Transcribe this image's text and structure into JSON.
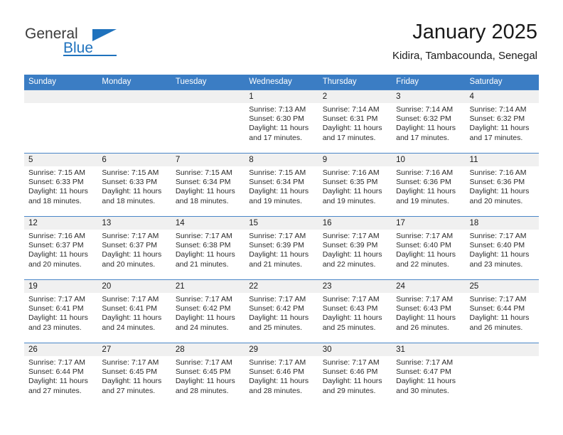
{
  "brand": {
    "line1": "General",
    "line2": "Blue",
    "flag_icon": "blue-triangle-flag-icon"
  },
  "header": {
    "title": "January 2025",
    "subtitle": "Kidira, Tambacounda, Senegal"
  },
  "colors": {
    "header_blue": "#3b7dc4",
    "brand_blue": "#1f72bd",
    "daynum_band": "#f0f0f0",
    "text": "#1a1a1a"
  },
  "weekday_headers": [
    "Sunday",
    "Monday",
    "Tuesday",
    "Wednesday",
    "Thursday",
    "Friday",
    "Saturday"
  ],
  "weeks": [
    [
      {
        "day": "",
        "sunrise": "",
        "sunset": "",
        "daylight1": "",
        "daylight2": ""
      },
      {
        "day": "",
        "sunrise": "",
        "sunset": "",
        "daylight1": "",
        "daylight2": ""
      },
      {
        "day": "",
        "sunrise": "",
        "sunset": "",
        "daylight1": "",
        "daylight2": ""
      },
      {
        "day": "1",
        "sunrise": "Sunrise: 7:13 AM",
        "sunset": "Sunset: 6:30 PM",
        "daylight1": "Daylight: 11 hours",
        "daylight2": "and 17 minutes."
      },
      {
        "day": "2",
        "sunrise": "Sunrise: 7:14 AM",
        "sunset": "Sunset: 6:31 PM",
        "daylight1": "Daylight: 11 hours",
        "daylight2": "and 17 minutes."
      },
      {
        "day": "3",
        "sunrise": "Sunrise: 7:14 AM",
        "sunset": "Sunset: 6:32 PM",
        "daylight1": "Daylight: 11 hours",
        "daylight2": "and 17 minutes."
      },
      {
        "day": "4",
        "sunrise": "Sunrise: 7:14 AM",
        "sunset": "Sunset: 6:32 PM",
        "daylight1": "Daylight: 11 hours",
        "daylight2": "and 17 minutes."
      }
    ],
    [
      {
        "day": "5",
        "sunrise": "Sunrise: 7:15 AM",
        "sunset": "Sunset: 6:33 PM",
        "daylight1": "Daylight: 11 hours",
        "daylight2": "and 18 minutes."
      },
      {
        "day": "6",
        "sunrise": "Sunrise: 7:15 AM",
        "sunset": "Sunset: 6:33 PM",
        "daylight1": "Daylight: 11 hours",
        "daylight2": "and 18 minutes."
      },
      {
        "day": "7",
        "sunrise": "Sunrise: 7:15 AM",
        "sunset": "Sunset: 6:34 PM",
        "daylight1": "Daylight: 11 hours",
        "daylight2": "and 18 minutes."
      },
      {
        "day": "8",
        "sunrise": "Sunrise: 7:15 AM",
        "sunset": "Sunset: 6:34 PM",
        "daylight1": "Daylight: 11 hours",
        "daylight2": "and 19 minutes."
      },
      {
        "day": "9",
        "sunrise": "Sunrise: 7:16 AM",
        "sunset": "Sunset: 6:35 PM",
        "daylight1": "Daylight: 11 hours",
        "daylight2": "and 19 minutes."
      },
      {
        "day": "10",
        "sunrise": "Sunrise: 7:16 AM",
        "sunset": "Sunset: 6:36 PM",
        "daylight1": "Daylight: 11 hours",
        "daylight2": "and 19 minutes."
      },
      {
        "day": "11",
        "sunrise": "Sunrise: 7:16 AM",
        "sunset": "Sunset: 6:36 PM",
        "daylight1": "Daylight: 11 hours",
        "daylight2": "and 20 minutes."
      }
    ],
    [
      {
        "day": "12",
        "sunrise": "Sunrise: 7:16 AM",
        "sunset": "Sunset: 6:37 PM",
        "daylight1": "Daylight: 11 hours",
        "daylight2": "and 20 minutes."
      },
      {
        "day": "13",
        "sunrise": "Sunrise: 7:17 AM",
        "sunset": "Sunset: 6:37 PM",
        "daylight1": "Daylight: 11 hours",
        "daylight2": "and 20 minutes."
      },
      {
        "day": "14",
        "sunrise": "Sunrise: 7:17 AM",
        "sunset": "Sunset: 6:38 PM",
        "daylight1": "Daylight: 11 hours",
        "daylight2": "and 21 minutes."
      },
      {
        "day": "15",
        "sunrise": "Sunrise: 7:17 AM",
        "sunset": "Sunset: 6:39 PM",
        "daylight1": "Daylight: 11 hours",
        "daylight2": "and 21 minutes."
      },
      {
        "day": "16",
        "sunrise": "Sunrise: 7:17 AM",
        "sunset": "Sunset: 6:39 PM",
        "daylight1": "Daylight: 11 hours",
        "daylight2": "and 22 minutes."
      },
      {
        "day": "17",
        "sunrise": "Sunrise: 7:17 AM",
        "sunset": "Sunset: 6:40 PM",
        "daylight1": "Daylight: 11 hours",
        "daylight2": "and 22 minutes."
      },
      {
        "day": "18",
        "sunrise": "Sunrise: 7:17 AM",
        "sunset": "Sunset: 6:40 PM",
        "daylight1": "Daylight: 11 hours",
        "daylight2": "and 23 minutes."
      }
    ],
    [
      {
        "day": "19",
        "sunrise": "Sunrise: 7:17 AM",
        "sunset": "Sunset: 6:41 PM",
        "daylight1": "Daylight: 11 hours",
        "daylight2": "and 23 minutes."
      },
      {
        "day": "20",
        "sunrise": "Sunrise: 7:17 AM",
        "sunset": "Sunset: 6:41 PM",
        "daylight1": "Daylight: 11 hours",
        "daylight2": "and 24 minutes."
      },
      {
        "day": "21",
        "sunrise": "Sunrise: 7:17 AM",
        "sunset": "Sunset: 6:42 PM",
        "daylight1": "Daylight: 11 hours",
        "daylight2": "and 24 minutes."
      },
      {
        "day": "22",
        "sunrise": "Sunrise: 7:17 AM",
        "sunset": "Sunset: 6:42 PM",
        "daylight1": "Daylight: 11 hours",
        "daylight2": "and 25 minutes."
      },
      {
        "day": "23",
        "sunrise": "Sunrise: 7:17 AM",
        "sunset": "Sunset: 6:43 PM",
        "daylight1": "Daylight: 11 hours",
        "daylight2": "and 25 minutes."
      },
      {
        "day": "24",
        "sunrise": "Sunrise: 7:17 AM",
        "sunset": "Sunset: 6:43 PM",
        "daylight1": "Daylight: 11 hours",
        "daylight2": "and 26 minutes."
      },
      {
        "day": "25",
        "sunrise": "Sunrise: 7:17 AM",
        "sunset": "Sunset: 6:44 PM",
        "daylight1": "Daylight: 11 hours",
        "daylight2": "and 26 minutes."
      }
    ],
    [
      {
        "day": "26",
        "sunrise": "Sunrise: 7:17 AM",
        "sunset": "Sunset: 6:44 PM",
        "daylight1": "Daylight: 11 hours",
        "daylight2": "and 27 minutes."
      },
      {
        "day": "27",
        "sunrise": "Sunrise: 7:17 AM",
        "sunset": "Sunset: 6:45 PM",
        "daylight1": "Daylight: 11 hours",
        "daylight2": "and 27 minutes."
      },
      {
        "day": "28",
        "sunrise": "Sunrise: 7:17 AM",
        "sunset": "Sunset: 6:45 PM",
        "daylight1": "Daylight: 11 hours",
        "daylight2": "and 28 minutes."
      },
      {
        "day": "29",
        "sunrise": "Sunrise: 7:17 AM",
        "sunset": "Sunset: 6:46 PM",
        "daylight1": "Daylight: 11 hours",
        "daylight2": "and 28 minutes."
      },
      {
        "day": "30",
        "sunrise": "Sunrise: 7:17 AM",
        "sunset": "Sunset: 6:46 PM",
        "daylight1": "Daylight: 11 hours",
        "daylight2": "and 29 minutes."
      },
      {
        "day": "31",
        "sunrise": "Sunrise: 7:17 AM",
        "sunset": "Sunset: 6:47 PM",
        "daylight1": "Daylight: 11 hours",
        "daylight2": "and 30 minutes."
      },
      {
        "day": "",
        "sunrise": "",
        "sunset": "",
        "daylight1": "",
        "daylight2": ""
      }
    ]
  ]
}
